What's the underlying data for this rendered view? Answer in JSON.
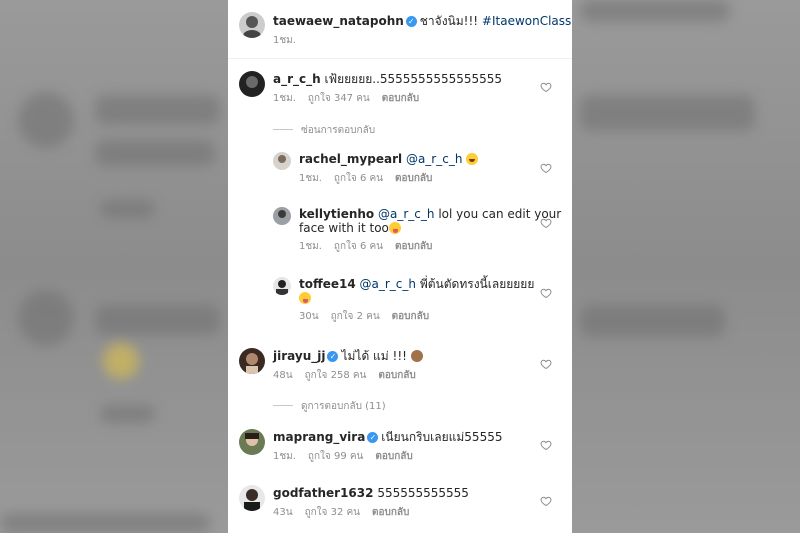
{
  "post": {
    "username": "taewaew_natapohn",
    "verified_mark": "✓",
    "caption_text": "ชาจังนิม!!! ",
    "hashtag": "#ItaewonClass",
    "time": "1ชม."
  },
  "comments": [
    {
      "username": "a_r_c_h",
      "text": "เฟ้ยยยยย..5555555555555555",
      "time": "1ชม.",
      "likes": "ถูกใจ 347 คน",
      "reply": "ตอบกลับ",
      "hide_replies": "ซ่อนการตอบกลับ",
      "replies": [
        {
          "username": "rachel_mypearl",
          "mention": "@a_r_c_h",
          "text": "",
          "time": "1ชม.",
          "likes": "ถูกใจ 6 คน",
          "reply": "ตอบกลับ"
        },
        {
          "username": "kellytienho",
          "mention": "@a_r_c_h",
          "text": "lol you can edit your",
          "text2": "face with it  too",
          "time": "1ชม.",
          "likes": "ถูกใจ 6 คน",
          "reply": "ตอบกลับ"
        },
        {
          "username": "toffee14",
          "mention": "@a_r_c_h",
          "text": "พี่ต้นตัดทรงนี้เลยยยยย",
          "time": "30น",
          "likes": "ถูกใจ 2 คน",
          "reply": "ตอบกลับ"
        }
      ]
    },
    {
      "username": "jirayu_jj",
      "text": "ไม่ได้ แม่ !!! ",
      "time": "48น",
      "likes": "ถูกใจ 258 คน",
      "reply": "ตอบกลับ",
      "view_replies": "ดูการตอบกลับ (11)"
    },
    {
      "username": "maprang_vira",
      "text": "เนียนกริบเลยแม่55555",
      "time": "1ชม.",
      "likes": "ถูกใจ 99 คน",
      "reply": "ตอบกลับ"
    },
    {
      "username": "godfather1632",
      "text": "555555555555",
      "time": "43น",
      "likes": "ถูกใจ 32 คน",
      "reply": "ตอบกลับ"
    }
  ],
  "colors": {
    "text": "#262626",
    "meta": "#8e8e8e",
    "mention": "#00376b",
    "verified": "#3897f0"
  },
  "icons": {
    "like": "heart-outline-icon"
  }
}
